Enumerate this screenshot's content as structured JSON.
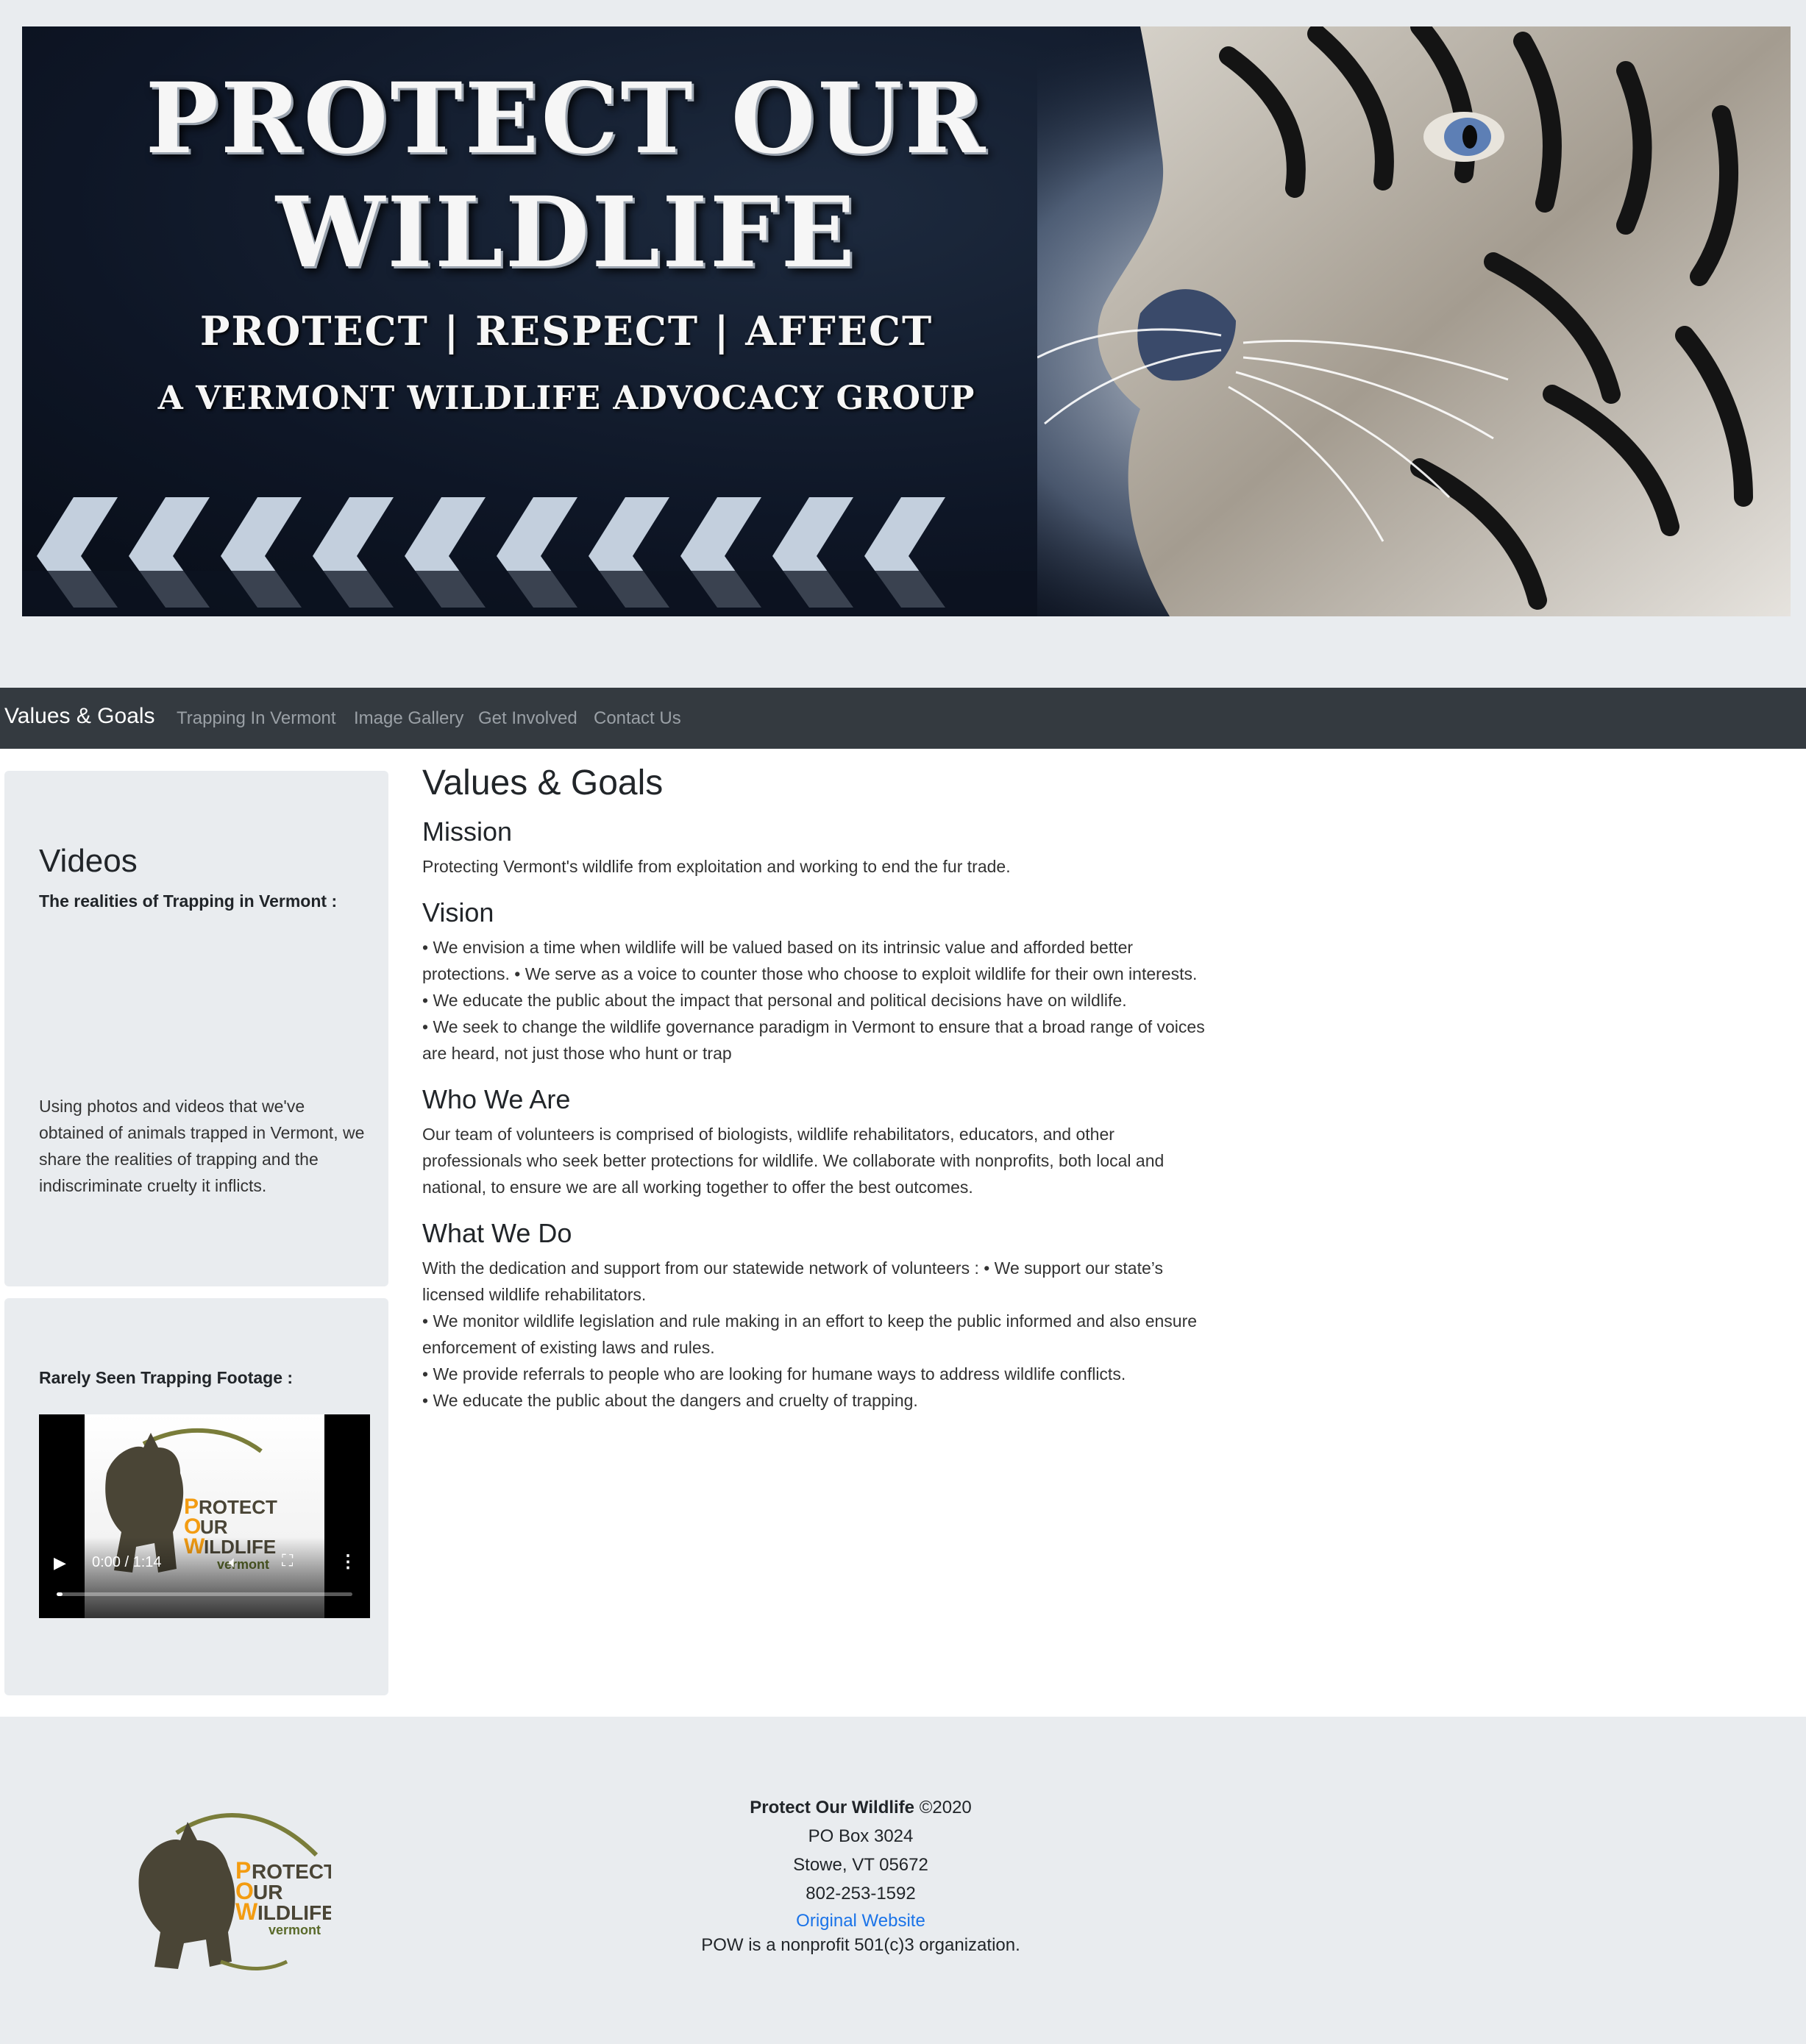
{
  "banner": {
    "title": "PROTECT OUR WILDLIFE",
    "tagline": "PROTECT | RESPECT | AFFECT",
    "subtitle": "A VERMONT WILDLIFE ADVOCACY GROUP"
  },
  "navbar": {
    "brand": "Values & Goals",
    "links": [
      "Trapping In Vermont",
      "Image Gallery",
      "Get Involved",
      "Contact Us"
    ]
  },
  "sidebar": {
    "videos_card": {
      "heading": "Videos",
      "lead": "The realities of Trapping in Vermont :",
      "text": "Using photos and videos that we've obtained of animals trapped in Vermont, we share the realities of trapping and the indiscriminate cruelty it inflicts."
    },
    "footage_card": {
      "lead": "Rarely Seen Trapping Footage :",
      "video": {
        "time": "0:00 / 1:14",
        "progress": 0.0,
        "poster_logo": [
          "PROTECT",
          "OUR",
          "WILDLIFE",
          "vermont"
        ]
      }
    }
  },
  "main": {
    "title": "Values & Goals",
    "sections": [
      {
        "heading": "Mission",
        "lines": [
          "Protecting Vermont's wildlife from exploitation and working to end the fur trade."
        ]
      },
      {
        "heading": "Vision",
        "lines": [
          "• We envision a time when wildlife will be valued based on its intrinsic value and afforded better protections. • We serve as a voice to counter those who choose to exploit wildlife for their own interests.",
          "• We educate the public about the impact that personal and political decisions have on wildlife.",
          "• We seek to change the wildlife governance paradigm in Vermont to ensure that a broad range of voices are heard, not just those who hunt or trap"
        ]
      },
      {
        "heading": "Who We Are",
        "lines": [
          "Our team of volunteers is comprised of biologists, wildlife rehabilitators, educators, and other professionals who seek better protections for wildlife. We collaborate with nonprofits, both local and national, to ensure we are all working together to offer the best outcomes."
        ]
      },
      {
        "heading": "What We Do",
        "lines": [
          "With the dedication and support from our statewide network of volunteers : • We support our state’s licensed wildlife rehabilitators.",
          "• We monitor wildlife legislation and rule making in an effort to keep the public informed and also ensure enforcement of existing laws and rules.",
          "• We provide referrals to people who are looking for humane ways to address wildlife conflicts.",
          "• We educate the public about the dangers and cruelty of trapping."
        ]
      }
    ]
  },
  "footer": {
    "org_name": "Protect Our Wildlife",
    "copyright": "©2020",
    "address1": "PO Box 3024",
    "address2": "Stowe, VT 05672",
    "phone": "802-253-1592",
    "link_label": "Original Website",
    "nonprofit": "POW is a nonprofit 501(c)3 organization.",
    "logo_text": [
      "PROTECT",
      "OUR",
      "WILDLIFE",
      "vermont"
    ]
  },
  "colors": {
    "page_bg": "#e9ecef",
    "navbar_bg": "#343a40",
    "link": "#1a73e8",
    "logo_accent": "#f39c12",
    "logo_dark": "#4a4536"
  }
}
